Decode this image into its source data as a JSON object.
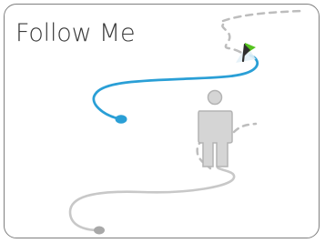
{
  "title": "Follow Me",
  "icons": {
    "user_path": "blue-path-icon",
    "follower_path": "gray-path-icon",
    "flag": "green-flag-icon",
    "person": "person-icon"
  },
  "colors": {
    "user_path": "#2a9fd6",
    "follower_path": "#c8c8c8",
    "dash": "#bdbdbd",
    "flag_green": "#55c31f",
    "flag_dark": "#2f2f2f",
    "person_fill": "#d5d5d5",
    "person_stroke": "#b3b3b3",
    "border": "#7f7f7f",
    "title_text": "#3a3a3a"
  }
}
